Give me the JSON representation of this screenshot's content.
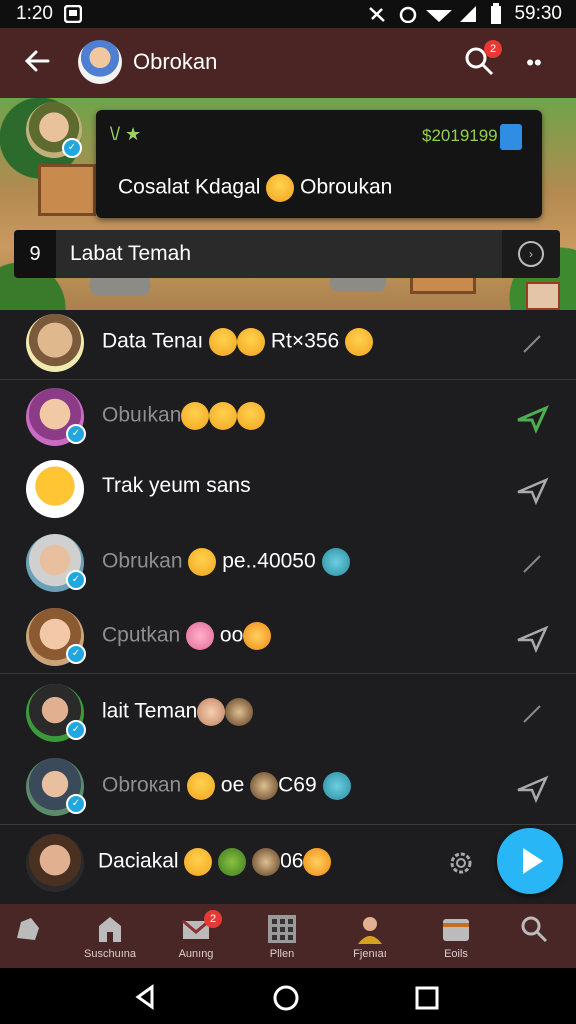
{
  "status_bar": {
    "time": "1:20",
    "clock": "59:30"
  },
  "header": {
    "title": "Obrokan",
    "search_badge": "2"
  },
  "bubble": {
    "tag": "\\/ ★",
    "amount": "$2019199",
    "message": "Cosalat Kdagal",
    "message_tail": "Obroukan"
  },
  "search_strip": {
    "number": "9",
    "label": "Labat Temah"
  },
  "rows": [
    {
      "text": "Data Tenaı",
      "tail": "Rt×356",
      "dim": false
    },
    {
      "text": "Obuıkan",
      "tail": "",
      "dim": true
    },
    {
      "text": "Trak yeum sans",
      "tail": "",
      "dim": false
    },
    {
      "text": "Obrukan",
      "tail": "pe..40050",
      "dim": true
    },
    {
      "text": "Cputkan",
      "tail": "oo",
      "dim": true
    },
    {
      "text": "lait Teman",
      "tail": "",
      "dim": false
    },
    {
      "text": "Obroкan",
      "tail": "oe",
      "tail2": "C69",
      "dim": true
    },
    {
      "text": "Daciakal",
      "tail": "06",
      "dim": false
    }
  ],
  "bottom_nav": {
    "items": [
      {
        "label": "",
        "icon": "home-shape-icon"
      },
      {
        "label": "Suschuına",
        "icon": "house-icon"
      },
      {
        "label": "Aunıng",
        "icon": "mail-icon",
        "badge": "2"
      },
      {
        "label": "Pllen",
        "icon": "grid-icon"
      },
      {
        "label": "Fjenıaı",
        "icon": "profile-icon"
      },
      {
        "label": "Eoils",
        "icon": "card-icon"
      },
      {
        "label": "",
        "icon": "search-icon"
      }
    ]
  },
  "colors": {
    "header": "#4b2424",
    "fab": "#29b6f6",
    "badge": "#e53935",
    "verify": "#20a7e0"
  }
}
